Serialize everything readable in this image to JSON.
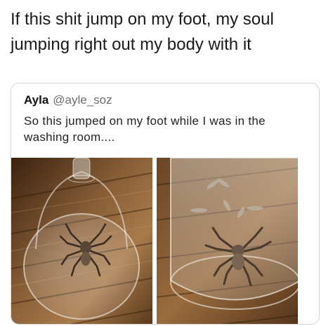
{
  "tweet": {
    "text": "If this shit jump on my foot, my soul jumping right out my body with it"
  },
  "quoted_tweet": {
    "author_name": "Ayla",
    "author_handle": "@ayle_soz",
    "text": "So this jumped on my foot while I was in the washing room...."
  },
  "images": [
    {
      "icon": "spider-under-glass-photo"
    },
    {
      "icon": "spider-under-glass-photo"
    }
  ],
  "colors": {
    "text": "#1a1a1a",
    "handle": "#6e6e6e",
    "card_border": "#d6d6d6",
    "wood_dark": "#4a2c14",
    "wood_light": "#a87a4a"
  }
}
